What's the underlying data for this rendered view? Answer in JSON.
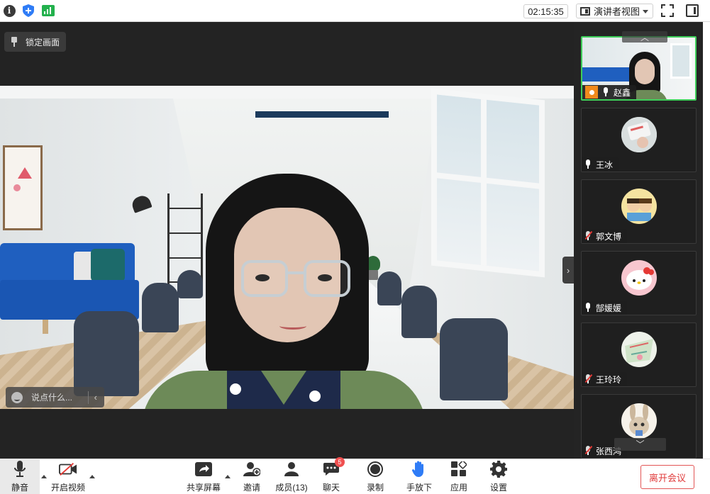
{
  "topbar": {
    "timer": "02:15:35",
    "view_mode": "演讲者视图"
  },
  "main": {
    "pin_label": "锁定画面",
    "chat_placeholder": "说点什么..."
  },
  "participants": [
    {
      "name": "赵鑫",
      "muted": false,
      "host": true,
      "active": true
    },
    {
      "name": "王冰",
      "muted": false,
      "host": false,
      "active": false
    },
    {
      "name": "郭文博",
      "muted": true,
      "host": false,
      "active": false
    },
    {
      "name": "郜媛媛",
      "muted": false,
      "host": false,
      "active": false
    },
    {
      "name": "王玲玲",
      "muted": true,
      "host": false,
      "active": false
    },
    {
      "name": "张西鸿",
      "muted": true,
      "host": false,
      "active": false
    }
  ],
  "toolbar": {
    "mute": "静音",
    "video": "开启视频",
    "share": "共享屏幕",
    "invite": "邀请",
    "members": "成员(13)",
    "chat": "聊天",
    "chat_badge": "5",
    "record": "录制",
    "hand": "手放下",
    "apps": "应用",
    "settings": "设置",
    "leave": "离开会议"
  },
  "colors": {
    "accent_green": "#3ecf5a",
    "leave_red": "#e03a3a",
    "hand_blue": "#2f7cf6",
    "host_orange": "#f08a1c"
  }
}
